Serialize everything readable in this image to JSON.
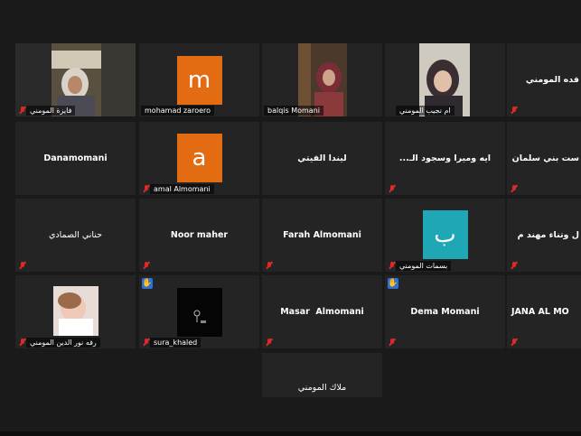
{
  "participants": {
    "r1": [
      {
        "name": "فايزة المومني"
      },
      {
        "name": "mohamad zaroero",
        "initial": "m"
      },
      {
        "name": "balqis Momani"
      },
      {
        "name": "ام نجيب المومني"
      },
      {
        "name": "فده المومني"
      }
    ],
    "r2": [
      {
        "name": "Danamomani"
      },
      {
        "name": "amal Almomani",
        "initial": "a"
      },
      {
        "name": "ليندا الفيتي"
      },
      {
        "name": "...ايه وميرا وسجود الـ"
      },
      {
        "name": "ست بني سلمان"
      }
    ],
    "r3": [
      {
        "name": "حناني الصمادي"
      },
      {
        "name": "Noor maher"
      },
      {
        "name": "Farah Almomani"
      },
      {
        "name": "بسمات المومني",
        "initial": "ب"
      },
      {
        "name": "ل وتناء مهند م"
      }
    ],
    "r4": [
      {
        "name": "رفه نور الدين المومني"
      },
      {
        "name": "sura_khaled"
      },
      {
        "name": "Masar  Almomani"
      },
      {
        "name": "Dema Momani"
      },
      {
        "name": "JANA AL MO"
      }
    ],
    "r5": [
      {
        "name": "ملاك المومني"
      }
    ]
  },
  "colors": {
    "active_border": "#c8d455",
    "avatar_orange": "#e36b12",
    "avatar_teal": "#1fa7b5",
    "muted_red": "#e02828",
    "raise_hand_blue": "#2f6fd6"
  },
  "icons": {
    "muted": "microphone-muted-icon",
    "raised_hand": "raised-hand-icon"
  }
}
